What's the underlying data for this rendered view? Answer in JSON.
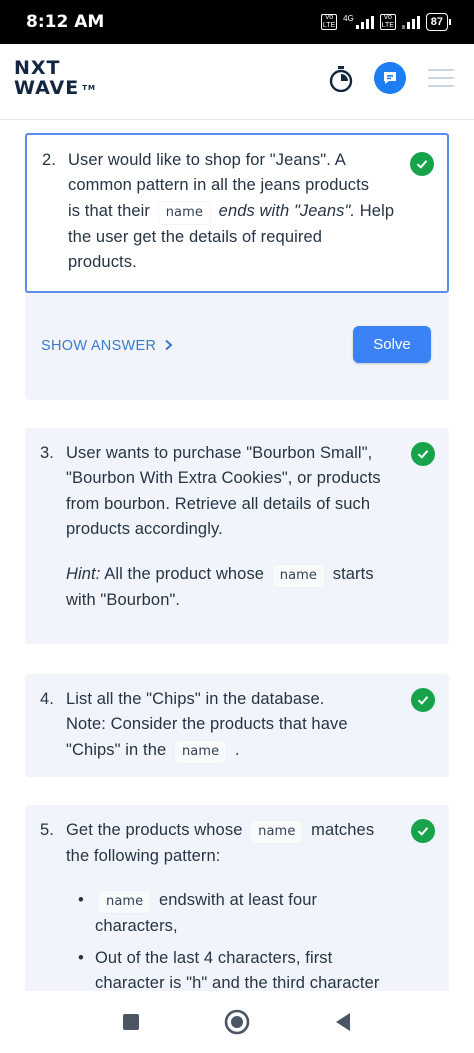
{
  "status_bar": {
    "time": "8:12 AM",
    "network": "4G",
    "volte1": "Vo LTE",
    "volte2": "Vo LTE",
    "battery": "87"
  },
  "header": {
    "logo_line1": "NXT",
    "logo_line2": "WAVE",
    "logo_tm": "TM",
    "icons": [
      "timer-icon",
      "chat-icon",
      "menu-icon"
    ]
  },
  "questions": [
    {
      "number": "2.",
      "line1": "User would like to shop for \"Jeans\". A",
      "line2": "common pattern in all the jeans products",
      "line3_pre": "is that their",
      "code": "name",
      "line3_post": "ends with \"Jeans\".",
      "line3_tail": "Help",
      "line4": "the user get the details of required",
      "line5": "products.",
      "show_answer": "SHOW ANSWER",
      "solve": "Solve",
      "completed": true
    },
    {
      "number": "3.",
      "line1": "User wants to purchase \"Bourbon Small\",",
      "line2": "\"Bourbon With Extra Cookies\", or products",
      "line3": "from bourbon. Retrieve all details of such",
      "line4": "products accordingly.",
      "hint_label": "Hint:",
      "hint_pre": "All the product whose",
      "hint_code": "name",
      "hint_post": "starts",
      "hint_line2": "with \"Bourbon\".",
      "completed": true
    },
    {
      "number": "4.",
      "line1": "List all the \"Chips\" in the database.",
      "line2": "Note: Consider the products that have",
      "line3_pre": "\"Chips\" in the",
      "code": "name",
      "line3_post": ".",
      "completed": true
    },
    {
      "number": "5.",
      "line1_pre": "Get the products whose",
      "code": "name",
      "line1_post": "matches",
      "line2": "the following pattern:",
      "bullet1_code": "name",
      "bullet1_post": "endswith at least four",
      "bullet1_line2": "characters,",
      "bullet2_line1": "Out of the last 4 characters, first",
      "bullet2_line2": "character is \"h\" and the third character",
      "completed": true
    }
  ],
  "nav": [
    "recent-apps-button",
    "home-button",
    "back-button"
  ],
  "colors": {
    "accent_blue": "#3b82f6",
    "check_green": "#16a34a",
    "card_bg": "#f1f5fb",
    "active_border": "#5b8def",
    "show_answer": "#3a7bc8"
  }
}
